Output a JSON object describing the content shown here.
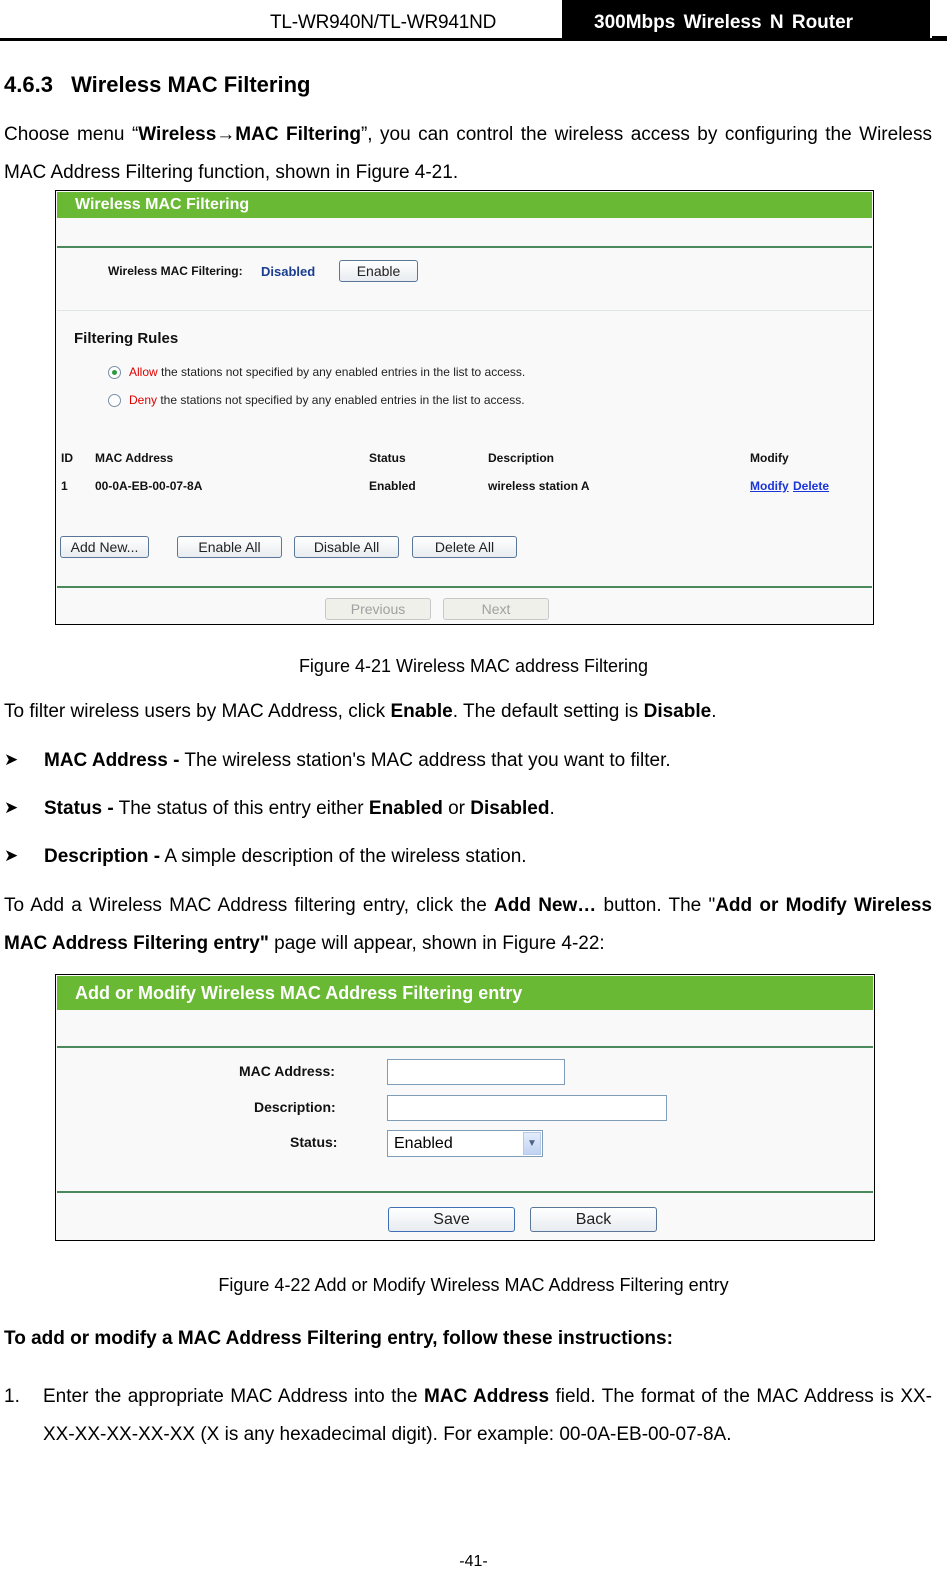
{
  "header": {
    "model": "TL-WR940N/TL-WR941ND",
    "product": "300Mbps  Wireless  N  Router"
  },
  "section": {
    "number": "4.6.3",
    "title": "Wireless MAC Filtering"
  },
  "intro": {
    "p1_a": "Choose menu “",
    "p1_menu": "Wireless→MAC Filtering",
    "p1_b": "”, you can control the wireless access by configuring the Wireless MAC Address Filtering function, shown in Figure 4-21."
  },
  "figure1": {
    "title": "Wireless MAC Filtering",
    "status_label": "Wireless MAC Filtering:",
    "status_value": "Disabled",
    "enable_button": "Enable",
    "rules_heading": "Filtering Rules",
    "rules": [
      {
        "keyword": "Allow",
        "text": " the stations not specified by any enabled entries in the list to access.",
        "selected": true
      },
      {
        "keyword": "Deny",
        "text": " the stations not specified by any enabled entries in the list to access.",
        "selected": false
      }
    ],
    "table": {
      "columns": [
        "ID",
        "MAC Address",
        "Status",
        "Description",
        "Modify"
      ],
      "rows": [
        {
          "id": "1",
          "mac": "00-0A-EB-00-07-8A",
          "status": "Enabled",
          "description": "wireless station A",
          "modify_link": "Modify",
          "delete_link": "Delete"
        }
      ]
    },
    "buttons": [
      "Add New...",
      "Enable All",
      "Disable All",
      "Delete All"
    ],
    "pager": {
      "previous": "Previous",
      "next": "Next"
    },
    "caption": "Figure 4-21    Wireless MAC address Filtering"
  },
  "body": {
    "p2_a": "To filter wireless users by MAC Address, click ",
    "p2_enable": "Enable",
    "p2_b": ". The default setting is ",
    "p2_disable": "Disable",
    "p2_c": ".",
    "bullets": [
      {
        "term": "MAC Address -",
        "text": " The wireless station's MAC address that you want to filter."
      },
      {
        "term": "Status -",
        "text": " The status of this entry either ",
        "b1": "Enabled",
        "mid": " or ",
        "b2": "Disabled",
        "end": "."
      },
      {
        "term": "Description -",
        "text": " A simple description of the wireless station."
      }
    ],
    "p3_a": "To Add a Wireless MAC Address filtering entry, click the ",
    "p3_addnew": "Add New…",
    "p3_b": " button. The \"",
    "p3_page": "Add or Modify Wireless MAC Address Filtering entry\"",
    "p3_c": " page will appear, shown in Figure 4-22:"
  },
  "figure2": {
    "title": "Add or Modify Wireless MAC Address Filtering entry",
    "mac_label": "MAC Address:",
    "mac_value": "",
    "description_label": "Description:",
    "description_value": "",
    "status_label": "Status:",
    "status_value": "Enabled",
    "save_button": "Save",
    "back_button": "Back",
    "caption": "Figure 4-22    Add or Modify Wireless MAC Address Filtering entry"
  },
  "instructions": {
    "heading": "To add or modify a MAC Address Filtering entry, follow these instructions:",
    "steps": [
      {
        "num": "1.",
        "a": "Enter the appropriate MAC Address into the ",
        "bold": "MAC Address",
        "b": " field. The format of the MAC Address is XX-XX-XX-XX-XX-XX (X is any hexadecimal digit). For example: 00-0A-EB-00-07-8A."
      }
    ]
  },
  "footer": {
    "page_number": "-41-"
  }
}
